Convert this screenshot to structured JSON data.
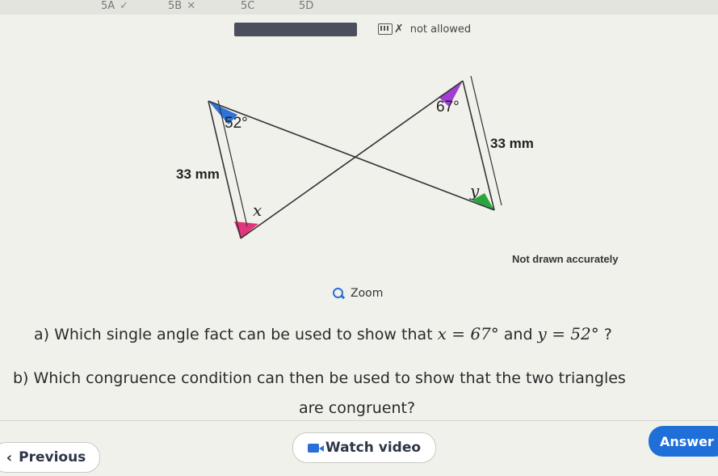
{
  "tabs": [
    {
      "label": "5A",
      "status": "✓"
    },
    {
      "label": "5B",
      "status": "✕"
    },
    {
      "label": "5C",
      "status": ""
    },
    {
      "label": "5D",
      "status": ""
    }
  ],
  "calculator": {
    "status_text": "not allowed",
    "icon": "calculator-icon"
  },
  "diagram": {
    "angle_top_left": "52°",
    "side_left": "33 mm",
    "var_x": "x",
    "angle_top_right": "67°",
    "side_right": "33 mm",
    "var_y": "y",
    "colors": {
      "blue": "#2f72d8",
      "pink": "#e3347e",
      "purple": "#a23fd3",
      "green": "#2aa53d"
    }
  },
  "note": "Not drawn accurately",
  "zoom": {
    "label": "Zoom"
  },
  "question": {
    "a_text": "a) Which single angle fact can be used to show that",
    "a_eq1": "x = 67°",
    "a_and": "and",
    "a_eq2": "y = 52°",
    "a_end": "?",
    "b_line1": "b) Which congruence condition can then be used to show that the two triangles",
    "b_line2": "are congruent?"
  },
  "buttons": {
    "previous": "Previous",
    "watch_video": "Watch video",
    "answer": "Answer"
  }
}
